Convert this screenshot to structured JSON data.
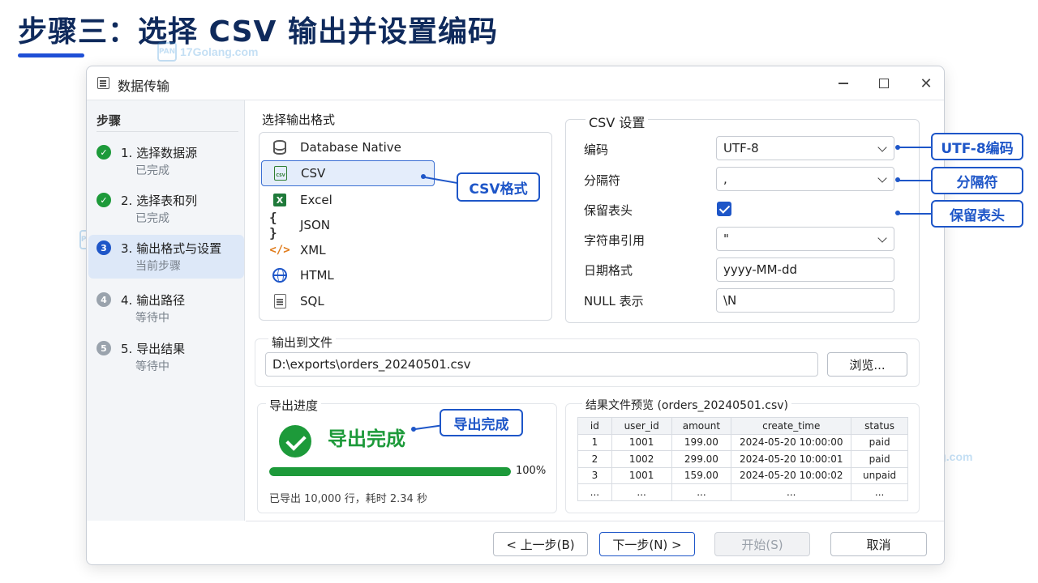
{
  "page": {
    "title": "步骤三：选择 CSV 输出并设置编码"
  },
  "watermark": {
    "text": "17Golang.com",
    "icon_text": "PAN"
  },
  "window": {
    "title": "数据传输",
    "icons": {
      "app": "table-window-icon",
      "minimize": "minimize-icon",
      "maximize": "maximize-icon",
      "close": "close-icon"
    },
    "close_glyph": "✕"
  },
  "sidebar": {
    "title": "步骤",
    "steps": [
      {
        "label": "1. 选择数据源",
        "status": "已完成",
        "state": "done",
        "marker": ""
      },
      {
        "label": "2. 选择表和列",
        "status": "已完成",
        "state": "done",
        "marker": ""
      },
      {
        "label": "3. 输出格式与设置",
        "status": "当前步骤",
        "state": "current",
        "marker": "3"
      },
      {
        "label": "4. 输出路径",
        "status": "等待中",
        "state": "wait",
        "marker": "4"
      },
      {
        "label": "5. 导出结果",
        "status": "等待中",
        "state": "wait",
        "marker": "5"
      }
    ]
  },
  "format": {
    "label": "选择输出格式",
    "items": [
      {
        "label": "Database Native",
        "icon": "database-icon",
        "glyph": ""
      },
      {
        "label": "CSV",
        "icon": "csv-file-icon",
        "glyph": "CSV",
        "selected": true
      },
      {
        "label": "Excel",
        "icon": "excel-icon",
        "glyph": "X"
      },
      {
        "label": "JSON",
        "icon": "json-braces-icon",
        "glyph": "{ }"
      },
      {
        "label": "XML",
        "icon": "xml-code-icon",
        "glyph": "</>"
      },
      {
        "label": "HTML",
        "icon": "globe-icon",
        "glyph": ""
      },
      {
        "label": "SQL",
        "icon": "sql-file-icon",
        "glyph": ""
      }
    ]
  },
  "csv_settings": {
    "title": "CSV 设置",
    "encoding": {
      "label": "编码",
      "value": "UTF-8"
    },
    "delimiter": {
      "label": "分隔符",
      "value": ","
    },
    "header": {
      "label": "保留表头",
      "checked": true
    },
    "quote": {
      "label": "字符串引用",
      "value": "\""
    },
    "date_format": {
      "label": "日期格式",
      "value": "yyyy-MM-dd"
    },
    "null_repr": {
      "label": "NULL 表示",
      "value": "\\N"
    }
  },
  "output": {
    "label": "输出到文件",
    "path": "D:\\exports\\orders_20240501.csv",
    "browse_label": "浏览..."
  },
  "progress": {
    "label": "导出进度",
    "status": "导出完成",
    "percent": 100,
    "percent_text": "100%",
    "info": "已导出 10,000 行，耗时 2.34 秒"
  },
  "preview": {
    "title": "结果文件预览  (orders_20240501.csv)",
    "columns": [
      "id",
      "user_id",
      "amount",
      "create_time",
      "status"
    ],
    "rows": [
      [
        "1",
        "1001",
        "199.00",
        "2024-05-20  10:00:00",
        "paid"
      ],
      [
        "2",
        "1002",
        "299.00",
        "2024-05-20  10:00:01",
        "paid"
      ],
      [
        "3",
        "1001",
        "159.00",
        "2024-05-20  10:00:02",
        "unpaid"
      ],
      [
        "...",
        "...",
        "...",
        "...",
        "..."
      ]
    ]
  },
  "footer": {
    "prev": "< 上一步(B)",
    "next": "下一步(N)  >",
    "start": "开始(S)",
    "cancel": "取消"
  },
  "callouts": {
    "csv": "CSV格式",
    "encoding": "UTF-8编码",
    "delimiter": "分隔符",
    "header": "保留表头",
    "done": "导出完成"
  },
  "colors": {
    "accent": "#1e56c8",
    "success": "#1d9a3a",
    "title": "#0f2a5c"
  }
}
